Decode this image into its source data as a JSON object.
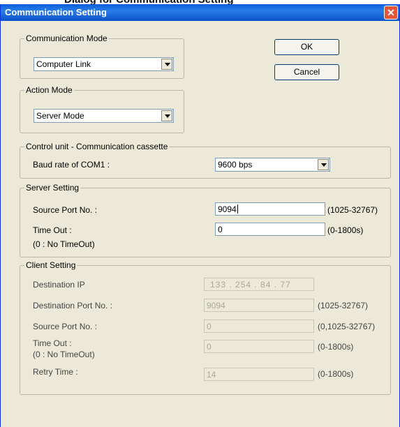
{
  "caption": "Dialog for Communication Setting",
  "window": {
    "title": "Communication Setting"
  },
  "communication_mode": {
    "legend": "Communication Mode",
    "value": "Computer Link"
  },
  "action_mode": {
    "legend": "Action Mode",
    "value": "Server Mode"
  },
  "buttons": {
    "ok": "OK",
    "cancel": "Cancel"
  },
  "control_unit": {
    "legend": "Control unit - Communication cassette",
    "baud_label": "Baud rate of COM1 :",
    "baud_value": "9600 bps"
  },
  "server": {
    "legend": "Server Setting",
    "source_port_label": "Source Port No. :",
    "source_port_value": "9094",
    "source_port_range": "(1025-32767)",
    "timeout_label": "Time Out :",
    "timeout_note": "(0 : No TimeOut)",
    "timeout_value": "0",
    "timeout_range": "(0-1800s)"
  },
  "client": {
    "legend": "Client Setting",
    "dest_ip_label": "Destination IP",
    "dest_ip_value": "133 . 254 . 84 . 77",
    "dest_port_label": "Destination Port No. :",
    "dest_port_value": "9094",
    "dest_port_range": "(1025-32767)",
    "source_port_label": "Source Port No. :",
    "source_port_value": "0",
    "source_port_range": "(0,1025-32767)",
    "timeout_label": "Time Out :",
    "timeout_note": "(0 : No TimeOut)",
    "timeout_value": "0",
    "timeout_range": "(0-1800s)",
    "retry_label": "Retry Time :",
    "retry_value": "14",
    "retry_range": "(0-1800s)"
  }
}
